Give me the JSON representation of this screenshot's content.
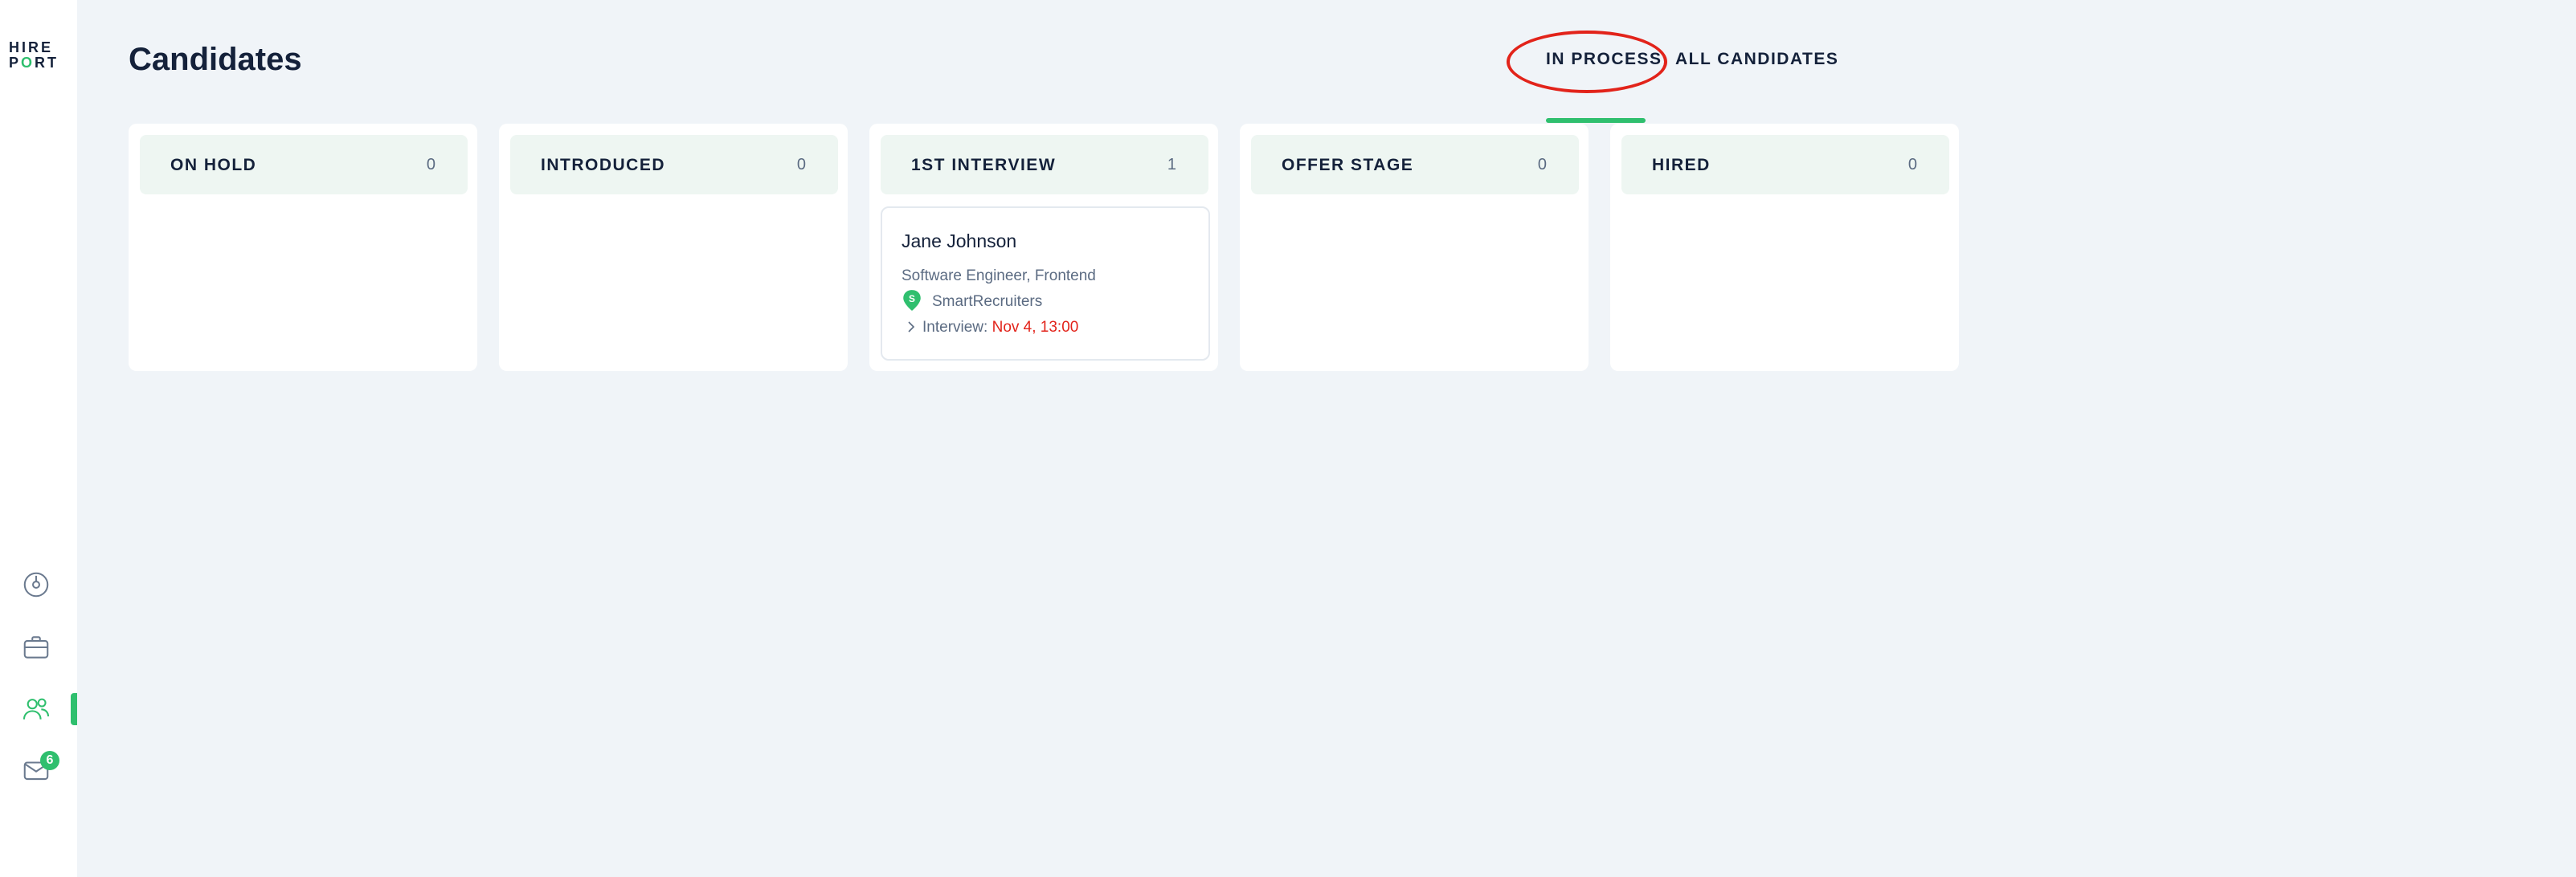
{
  "sidebar": {
    "logo_line1": "HIRE",
    "logo_line2_a": "P",
    "logo_line2_o": "O",
    "logo_line2_b": "RT",
    "items": [
      {
        "icon": "dashboard-icon"
      },
      {
        "icon": "briefcase-icon"
      },
      {
        "icon": "candidates-icon",
        "active": true
      },
      {
        "icon": "mail-icon",
        "badge": "6"
      }
    ]
  },
  "header": {
    "title": "Candidates",
    "tabs": [
      {
        "label": "IN PROCESS",
        "active": true
      },
      {
        "label": "ALL CANDIDATES",
        "active": false
      }
    ]
  },
  "columns": [
    {
      "title": "ON HOLD",
      "count": "0"
    },
    {
      "title": "INTRODUCED",
      "count": "0"
    },
    {
      "title": "1ST INTERVIEW",
      "count": "1"
    },
    {
      "title": "OFFER STAGE",
      "count": "0"
    },
    {
      "title": "HIRED",
      "count": "0"
    }
  ],
  "candidate": {
    "name": "Jane Johnson",
    "role": "Software Engineer, Frontend",
    "source": "SmartRecruiters",
    "interview_label": "Interview: ",
    "interview_date": "Nov 4, 13:00"
  },
  "colors": {
    "accent": "#2fbf6e",
    "alert": "#e2231a",
    "text_primary": "#14213a",
    "text_secondary": "#5b6b82",
    "background": "#f0f4f8"
  }
}
